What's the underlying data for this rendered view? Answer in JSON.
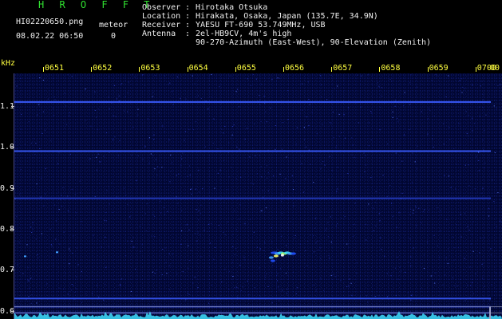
{
  "header": {
    "brand": "H R O F F T",
    "filename": "HI02220650.png",
    "timestamp": "08.02.22 06:50",
    "meteor_label": "meteor",
    "meteor_count": "0"
  },
  "station_info": [
    {
      "key": "Observer",
      "value": "Hirotaka Otsuka"
    },
    {
      "key": "Location",
      "value": "Hirakata, Osaka, Japan (135.7E, 34.9N)"
    },
    {
      "key": "Receiver",
      "value": "YAESU FT-690 53.749MHz, USB"
    },
    {
      "key": "Antenna",
      "value": "2el-HB9CV, 4m's high"
    },
    {
      "key": "",
      "value": "90-270-Azimuth (East-West), 90-Elevation (Zenith)"
    }
  ],
  "colors": {
    "background": "#000000",
    "plot_background": "#010630",
    "label_yellow": "#ffff40",
    "brand_green": "#30e030",
    "signal_blue": "#3a5cff",
    "signal_cyan": "#40e0ff"
  },
  "chart_data": {
    "type": "heatmap",
    "y_unit_label": "kHz",
    "x_ticks": [
      "0651",
      "0652",
      "0653",
      "0654",
      "0655",
      "0656",
      "0657",
      "0658",
      "0659",
      "0700",
      "00"
    ],
    "y_ticks": [
      "1.1",
      "1.0",
      "0.9",
      "0.8",
      "0.7",
      "0.6"
    ],
    "y_range": [
      0.58,
      1.18
    ],
    "x_range": [
      0,
      10
    ],
    "steady_carriers_khz": [
      {
        "freq": 1.11,
        "intensity": 0.9
      },
      {
        "freq": 0.99,
        "intensity": 0.85
      },
      {
        "freq": 0.875,
        "intensity": 0.6
      },
      {
        "freq": 0.63,
        "intensity": 0.75
      },
      {
        "freq": 0.61,
        "intensity": 0.35
      },
      {
        "freq": 0.595,
        "intensity": 0.35
      }
    ],
    "echo_event": {
      "time": 4.75,
      "freq": 0.73,
      "intensity": 1.0
    }
  }
}
